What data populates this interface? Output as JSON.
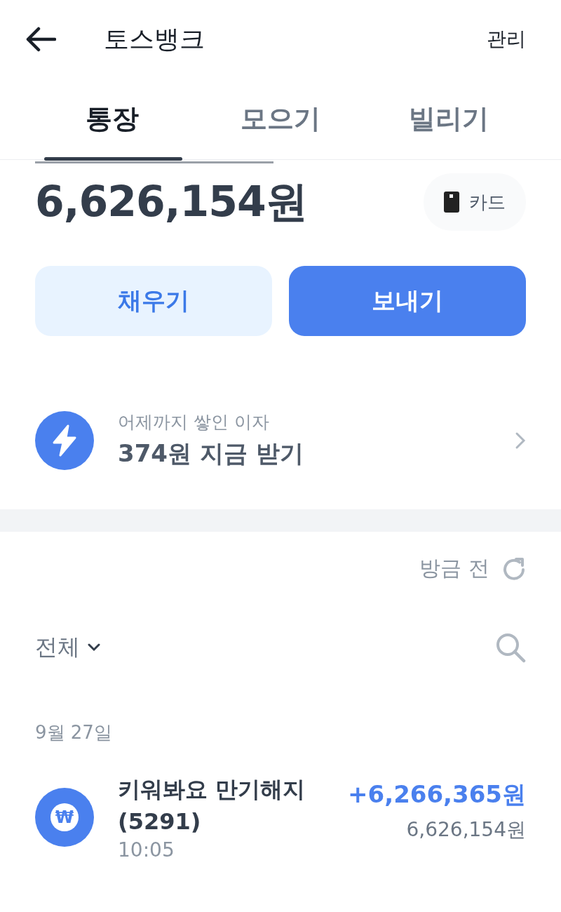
{
  "header": {
    "title": "토스뱅크",
    "action": "관리"
  },
  "tabs": [
    {
      "label": "통장",
      "selected": true
    },
    {
      "label": "모으기",
      "selected": false
    },
    {
      "label": "빌리기",
      "selected": false
    }
  ],
  "balance": {
    "amount": "6,626,154원",
    "card_button": "카드"
  },
  "actions": [
    {
      "label": "채우기",
      "kind": "secondary"
    },
    {
      "label": "보내기",
      "kind": "primary"
    }
  ],
  "interest": {
    "caption": "어제까지 쌓인 이자",
    "title": "374원 지금 받기"
  },
  "refresh": {
    "label": "방금 전"
  },
  "filter": {
    "label": "전체"
  },
  "groups": [
    {
      "date": "9월 27일",
      "transactions": [
        {
          "icon": "₩",
          "title": "키워봐요 만기해지 (5291)",
          "time": "10:05",
          "amount": "+6,266,365원",
          "balance": "6,626,154원",
          "kind": "deposit"
        }
      ]
    }
  ]
}
